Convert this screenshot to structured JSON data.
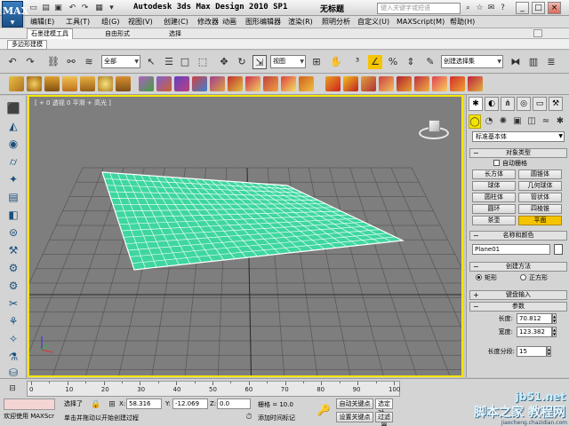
{
  "window": {
    "logo_text": "MAX",
    "title": "Autodesk 3ds Max Design 2010 SP1",
    "document": "无标题",
    "search_placeholder": "键入关键字或短语",
    "controls": [
      "_",
      "□",
      "×"
    ]
  },
  "menu": [
    "编辑(E)",
    "工具(T)",
    "组(G)",
    "视图(V)",
    "创建(C)",
    "修改器",
    "动画",
    "图形编辑器",
    "渲染(R)",
    "照明分析",
    "自定义(U)",
    "MAXScript(M)",
    "帮助(H)"
  ],
  "ribbon": {
    "tabs": [
      "石墨建模工具",
      "自由形式",
      "选择"
    ],
    "sub_tab": "多边形建模"
  },
  "toolbar": {
    "selection_filter": "全部",
    "ref_coord": "视图",
    "named_selection": "创建选择集"
  },
  "viewport": {
    "label": "[ + 0 透视 0 平滑 + 高光 ]",
    "type": "透视"
  },
  "command_panel": {
    "category": "标准基本体",
    "object_type_title": "对象类型",
    "autogrid_label": "自动栅格",
    "object_buttons": [
      "长方体",
      "圆锥体",
      "球体",
      "几何球体",
      "圆柱体",
      "管状体",
      "圆环",
      "四棱锥",
      "茶壶",
      "平面"
    ],
    "active_object": "平面",
    "name_color_title": "名称和颜色",
    "object_name": "Plane01",
    "creation_method_title": "创建方法",
    "method_rect": "矩形",
    "method_square": "正方形",
    "keyboard_entry_title": "键盘输入",
    "parameters_title": "参数",
    "length_label": "长度:",
    "length_value": "70.812",
    "width_label": "宽度:",
    "width_value": "123.382",
    "length_segs_label": "长度分段:",
    "length_segs_value": "15"
  },
  "timeline": {
    "ticks": [
      "0",
      "10",
      "20",
      "30",
      "40",
      "50",
      "60",
      "70",
      "80",
      "90",
      "100"
    ]
  },
  "status": {
    "welcome": "欢迎使用 MAXScr",
    "selection": "选择了",
    "prompt": "单击并拖动以开始创建过程",
    "x_label": "X:",
    "x_value": "58.316",
    "y_label": "Y:",
    "y_value": "-12.069",
    "z_label": "Z:",
    "z_value": "0.0",
    "grid": "栅格 = 10.0",
    "add_time_tag": "添加时间标记",
    "auto_key": "自动关键点",
    "set_key": "设置关键点",
    "selected_label": "选定对",
    "filter_label": "过滤器"
  },
  "watermark": {
    "site": "jb51.net",
    "text": "脚本之家 教程网",
    "url": "jiaocheng.chazidian.com"
  },
  "colors": {
    "plane_fill": "#3fd6a0",
    "viewport_bg": "#7e7e7e",
    "active_border": "#f5e400",
    "active_button": "#f5c400"
  }
}
